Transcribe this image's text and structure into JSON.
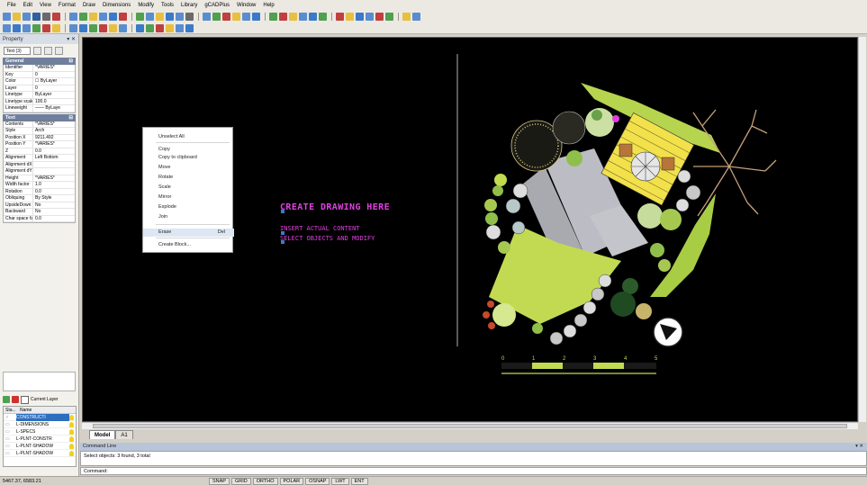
{
  "menubar": {
    "items": [
      "File",
      "Edit",
      "View",
      "Format",
      "Draw",
      "Dimensions",
      "Modify",
      "Tools",
      "Library",
      "gCADPlus",
      "Window",
      "Help"
    ]
  },
  "toolbar": {
    "row1_colors": [
      "#5a8dd0",
      "#e8c040",
      "#5a8dd0",
      "#3060a0",
      "#6a6a6a",
      "#c04040",
      "#5a8dd0",
      "#50a050",
      "#e8c040",
      "#5a8dd0",
      "#3a7ac8",
      "#c04040",
      "#50a050",
      "#5a8dd0",
      "#e8c040",
      "#3a7ac8",
      "#5a8dd0",
      "#6a6a6a",
      "#5a8dd0",
      "#50a050",
      "#c04040",
      "#e8c040",
      "#5a8dd0",
      "#3a7ac8",
      "#50a050",
      "#c04040",
      "#e8c040",
      "#5a8dd0",
      "#3a7ac8",
      "#50a050",
      "#c04040",
      "#e8c040",
      "#3a7ac8",
      "#5a8dd0",
      "#c04040",
      "#50a050",
      "#e8c040",
      "#5a8dd0"
    ],
    "row2_colors": [
      "#5a8dd0",
      "#3a7ac8",
      "#5a8dd0",
      "#50a050",
      "#c04040",
      "#e8c040",
      "#5a8dd0",
      "#3a7ac8",
      "#50a050",
      "#c04040",
      "#e8c040",
      "#5a8dd0",
      "#3a7ac8",
      "#50a050",
      "#c04040",
      "#e8c040",
      "#5a8dd0",
      "#3a7ac8"
    ]
  },
  "properties": {
    "title": "Property",
    "combo_value": "Text (3)",
    "general_header": "General",
    "general": [
      {
        "k": "Identifier",
        "v": "*VARIES*"
      },
      {
        "k": "Key",
        "v": "0"
      },
      {
        "k": "Color",
        "v": "☐ ByLayer"
      },
      {
        "k": "Layer",
        "v": "0"
      },
      {
        "k": "Linetype",
        "v": "ByLayer"
      },
      {
        "k": "Linetype scale",
        "v": "100.0"
      },
      {
        "k": "Lineweight",
        "v": "—— ByLaye"
      }
    ],
    "text_header": "Text",
    "text": [
      {
        "k": "Contents",
        "v": "*VARIES*"
      },
      {
        "k": "Style",
        "v": "Arch"
      },
      {
        "k": "Position X",
        "v": "9211.492"
      },
      {
        "k": "Position Y",
        "v": "*VARIES*"
      },
      {
        "k": "Z",
        "v": "0.0"
      },
      {
        "k": "Alignment",
        "v": "Left Bottom"
      },
      {
        "k": "Alignment dX",
        "v": ""
      },
      {
        "k": "Alignment dY",
        "v": ""
      },
      {
        "k": "Height",
        "v": "*VARIES*"
      },
      {
        "k": "Width factor",
        "v": "1.0"
      },
      {
        "k": "Rotation",
        "v": "0.0"
      },
      {
        "k": "Obliquing",
        "v": "By Style"
      },
      {
        "k": "UpsideDown",
        "v": "No"
      },
      {
        "k": "Backward",
        "v": "No"
      },
      {
        "k": "Char space fac",
        "v": "0.0"
      }
    ]
  },
  "layers": {
    "current_label": "Current Layer",
    "col_status": "Sta...",
    "col_name": "Name",
    "rows": [
      {
        "name": "CONSTRUCTI",
        "selected": true
      },
      {
        "name": "L-DIMENSIONS",
        "selected": false
      },
      {
        "name": "L-SPECS",
        "selected": false
      },
      {
        "name": "L-PLNT-CONSTR",
        "selected": false
      },
      {
        "name": "L-PLNT-SHADOW",
        "selected": false
      },
      {
        "name": "L-PLNT-SHADOW",
        "selected": false
      }
    ]
  },
  "context_menu": {
    "items": [
      "Unselect All",
      "Copy",
      "Copy to clipboard",
      "Move",
      "Rotate",
      "Scale",
      "Mirror",
      "Explode",
      "Join",
      "Erase",
      "Create Block..."
    ],
    "erase_shortcut": "Del"
  },
  "drawing_text": {
    "line1": "CREATE DRAWING HERE",
    "line2": "INSERT ACTUAL CONTENT",
    "line3": "SELECT OBJECTS AND MODIFY"
  },
  "scale_bar": {
    "labels": [
      "0",
      "1",
      "2",
      "3",
      "4",
      "5"
    ]
  },
  "tabs": {
    "model": "Model",
    "layout": "A1"
  },
  "command": {
    "title": "Command Line",
    "history": "Select objects: 3 found, 3 total",
    "prompt": "Command:"
  },
  "status": {
    "coords": "5467.37, 6583.21",
    "buttons": [
      "SNAP",
      "GRID",
      "ORTHO",
      "POLAR",
      "OSNAP",
      "LWT",
      "ENT"
    ]
  }
}
